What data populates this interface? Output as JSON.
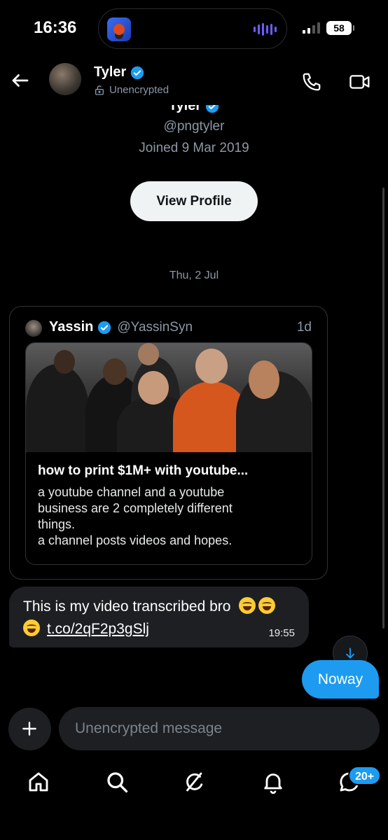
{
  "status_bar": {
    "time": "16:36",
    "battery": "58"
  },
  "header": {
    "name": "Tyler",
    "subtitle": "Unencrypted"
  },
  "profile": {
    "name": "Tyler",
    "handle": "@pngtyler",
    "joined": "Joined 9 Mar 2019",
    "view_profile_label": "View Profile"
  },
  "date_separator": "Thu, 2 Jul",
  "shared_post": {
    "author": "Yassin",
    "handle": "@YassinSyn",
    "time": "1d",
    "link_title": "how to print $1M+ with youtube...",
    "link_desc_lines": [
      "a youtube channel and a youtube",
      "business are 2 completely different",
      "things.",
      "a channel posts videos and hopes."
    ]
  },
  "messages": {
    "incoming": {
      "line1": "This is my video transcribed bro",
      "link": "t.co/2qF2p3gSlj",
      "time": "19:55"
    },
    "outgoing": {
      "text": "Noway"
    }
  },
  "composer": {
    "placeholder": "Unencrypted message"
  },
  "nav": {
    "messages_badge": "20+"
  },
  "colors": {
    "accent": "#1d9bf0",
    "bubble_in": "#1d1f23",
    "background": "#000000"
  }
}
